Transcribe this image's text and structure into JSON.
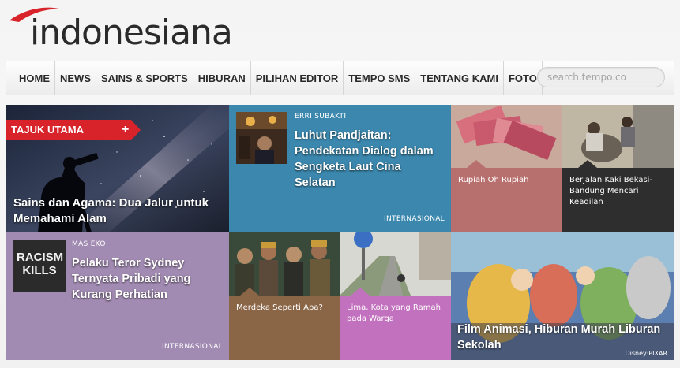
{
  "logo": {
    "text": "indonesiana"
  },
  "nav": {
    "items": [
      {
        "label": "HOME"
      },
      {
        "label": "NEWS"
      },
      {
        "label": "SAINS & SPORTS"
      },
      {
        "label": "HIBURAN"
      },
      {
        "label": "PILIHAN EDITOR"
      },
      {
        "label": "TEMPO SMS"
      },
      {
        "label": "TENTANG KAMI"
      },
      {
        "label": "FOTO"
      }
    ],
    "search_placeholder": "search.tempo.co"
  },
  "tiles": [
    {
      "badge": "TAJUK UTAMA",
      "badge_icon": "plus-icon",
      "title": "Sains dan Agama: Dua Jalur untuk Memahami Alam",
      "color": "#0d1320"
    },
    {
      "author": "ERRI SUBAKTI",
      "title": "Luhut Pandjaitan: Pendekatan Dialog dalam Sengketa Laut Cina Selatan",
      "category": "INTERNASIONAL",
      "color": "#3b87ad"
    },
    {
      "title": "Rupiah Oh Rupiah",
      "color": "#b8706f"
    },
    {
      "title": "Berjalan Kaki Bekasi-Bandung Mencari Keadilan",
      "color": "#2e2e2e"
    },
    {
      "author": "MAS EKO",
      "thumb_text": "RACISM KILLS",
      "title": "Pelaku Teror Sydney Ternyata Pribadi yang Kurang Perhatian",
      "category": "INTERNASIONAL",
      "color": "#a28bb2"
    },
    {
      "title": "Merdeka Seperti Apa?",
      "color": "#8a6546"
    },
    {
      "title": "Lima, Kota yang Ramah pada Warga",
      "color": "#c171bd"
    },
    {
      "title": "Film Animasi, Hiburan Murah Liburan Sekolah",
      "watermark": "Disney·PIXAR",
      "color": "#3a6b9a"
    }
  ]
}
